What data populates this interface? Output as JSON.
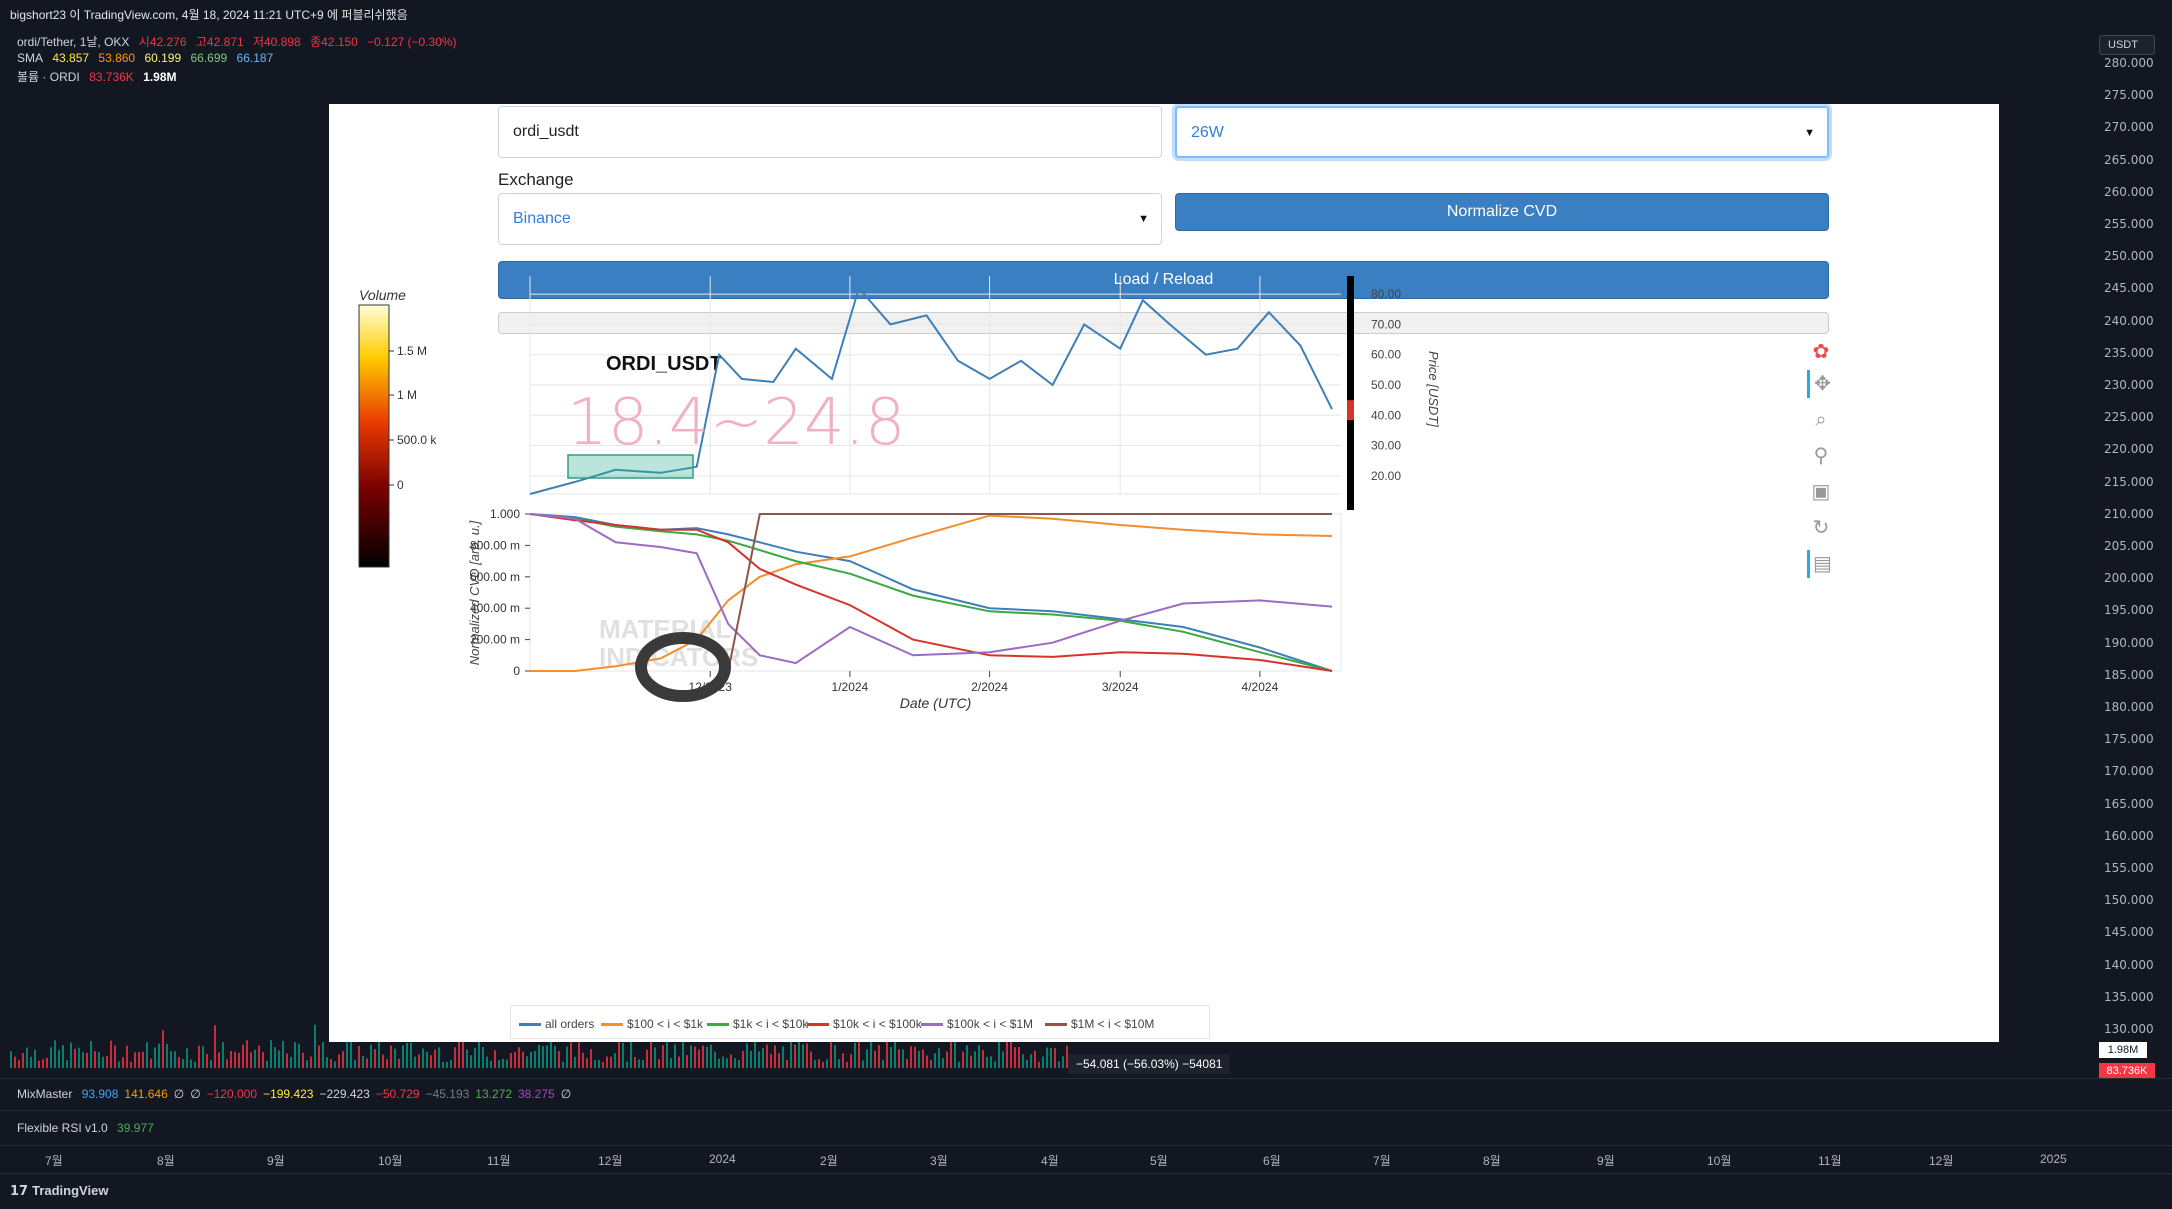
{
  "header": {
    "credit": "bigshort23 이 TradingView.com, 4월 18, 2024 11:21 UTC+9 에 퍼블리쉬했음",
    "symbol_line": "ordi/Tether, 1날, OKX",
    "o": "시42.276",
    "h": "고42.871",
    "l": "저40.898",
    "c": "종42.150",
    "change": "−0.127 (−0.30%)",
    "sma_label": "SMA",
    "sma_values": [
      "43.857",
      "53.860",
      "60.199",
      "66.699",
      "66.187"
    ],
    "vol_label": "볼륨 · ORDI",
    "vol_values": [
      "83.736K",
      "1.98M"
    ]
  },
  "price_axis": {
    "currency": "USDT",
    "labels": [
      "280.000",
      "275.000",
      "270.000",
      "265.000",
      "260.000",
      "255.000",
      "250.000",
      "245.000",
      "240.000",
      "235.000",
      "230.000",
      "225.000",
      "220.000",
      "215.000",
      "210.000",
      "205.000",
      "200.000",
      "195.000",
      "190.000",
      "185.000",
      "180.000",
      "175.000",
      "170.000",
      "165.000",
      "160.000",
      "155.000",
      "150.000",
      "145.000",
      "140.000",
      "135.000",
      "130.000"
    ],
    "vol_tag_1": "1.98M",
    "vol_tag_2": "83.736K"
  },
  "tooltip": "−54.081 (−56.03%) −54081",
  "indicators": {
    "mixmaster": {
      "name": "MixMaster",
      "values": [
        {
          "v": "93.908",
          "color": "#42a5f5"
        },
        {
          "v": "141.646",
          "color": "#ff9800"
        },
        {
          "v": "∅",
          "color": "#d1d4dc"
        },
        {
          "v": "∅",
          "color": "#d1d4dc"
        },
        {
          "v": "−120.000",
          "color": "#f23645"
        },
        {
          "v": "−199.423",
          "color": "#ffeb3b"
        },
        {
          "v": "−229.423",
          "color": "#d1d4dc"
        },
        {
          "v": "−50.729",
          "color": "#f23645"
        },
        {
          "v": "−45.193",
          "color": "#787b86"
        },
        {
          "v": "13.272",
          "color": "#4caf50"
        },
        {
          "v": "38.275",
          "color": "#ab47bc"
        },
        {
          "v": "∅",
          "color": "#d1d4dc"
        }
      ]
    },
    "rsi": {
      "name": "Flexible RSI v1.0",
      "value": "39.977"
    }
  },
  "time_axis": [
    "7월",
    "8월",
    "9월",
    "10월",
    "11월",
    "12월",
    "2024",
    "2월",
    "3월",
    "4월",
    "5월",
    "6월",
    "7월",
    "8월",
    "9월",
    "10월",
    "11월",
    "12월",
    "2025"
  ],
  "footer": {
    "logo": "TradingView"
  },
  "embed": {
    "symbol_input": "ordi_usdt",
    "period_select": "26W",
    "exchange_label": "Exchange",
    "exchange_select": "Binance",
    "normalize_btn": "Normalize CVD",
    "load_btn": "Load / Reload",
    "chart_title": "ORDI_USDT",
    "volume_title": "Volume",
    "colorbar_ticks": [
      "1.5 M",
      "1 M",
      "500.0 k",
      "0"
    ],
    "price_ylabel": "Price [USDT]",
    "price_ticks": [
      "80.00",
      "70.00",
      "60.00",
      "50.00",
      "40.00",
      "30.00",
      "20.00"
    ],
    "cvd_ylabel": "Normalized CVD [arb. u.]",
    "cvd_ticks": [
      "1.000",
      "800.00 m",
      "600.00 m",
      "400.00 m",
      "200.00 m",
      "0"
    ],
    "x_ticks": [
      "12/2023",
      "1/2024",
      "2/2024",
      "3/2024",
      "4/2024"
    ],
    "xlabel": "Date (UTC)",
    "annotation": "18.4~24.8",
    "watermark": "MATERIAL INDICATORS",
    "legend": [
      {
        "label": "all orders",
        "color": "#3d7fb6"
      },
      {
        "label": "$100 < i < $1k",
        "color": "#f28e2b"
      },
      {
        "label": "$1k < i < $10k",
        "color": "#3aa844"
      },
      {
        "label": "$10k < i < $100k",
        "color": "#d6342b"
      },
      {
        "label": "$100k < i < $1M",
        "color": "#9b6bc6"
      },
      {
        "label": "$1M < i < $10M",
        "color": "#8c564b"
      }
    ]
  },
  "chart_data": [
    {
      "type": "line",
      "title": "ORDI_USDT",
      "ylabel": "Price [USDT]",
      "xlabel": "",
      "x": [
        "2023-10-22",
        "2023-11-01",
        "2023-11-10",
        "2023-11-20",
        "2023-11-28",
        "2023-12-03",
        "2023-12-08",
        "2023-12-15",
        "2023-12-20",
        "2023-12-28",
        "2024-01-03",
        "2024-01-10",
        "2024-01-18",
        "2024-01-25",
        "2024-02-01",
        "2024-02-08",
        "2024-02-15",
        "2024-02-22",
        "2024-03-01",
        "2024-03-06",
        "2024-03-12",
        "2024-03-20",
        "2024-03-27",
        "2024-04-03",
        "2024-04-10",
        "2024-04-17"
      ],
      "series": [
        {
          "values": [
            14,
            18,
            22,
            21,
            23,
            60,
            52,
            51,
            62,
            52,
            82,
            70,
            73,
            58,
            52,
            58,
            50,
            70,
            62,
            78,
            70,
            60,
            62,
            74,
            63,
            42
          ]
        }
      ],
      "ylim": [
        14,
        86
      ]
    },
    {
      "type": "line",
      "ylabel": "Normalized CVD [arb. u.]",
      "xlabel": "Date (UTC)",
      "x": [
        "2023-10-22",
        "2023-11-01",
        "2023-11-10",
        "2023-11-20",
        "2023-11-28",
        "2023-12-05",
        "2023-12-12",
        "2023-12-20",
        "2024-01-01",
        "2024-01-15",
        "2024-02-01",
        "2024-02-15",
        "2024-03-01",
        "2024-03-15",
        "2024-04-01",
        "2024-04-17"
      ],
      "series": [
        {
          "name": "all orders",
          "values": [
            1.0,
            0.98,
            0.93,
            0.9,
            0.91,
            0.87,
            0.82,
            0.76,
            0.7,
            0.52,
            0.4,
            0.38,
            0.33,
            0.28,
            0.15,
            0.0
          ]
        },
        {
          "name": "$100 < i < $1k",
          "values": [
            0.0,
            0.0,
            0.03,
            0.08,
            0.2,
            0.45,
            0.6,
            0.68,
            0.73,
            0.85,
            0.99,
            0.97,
            0.93,
            0.9,
            0.87,
            0.86
          ]
        },
        {
          "name": "$1k < i < $10k",
          "values": [
            1.0,
            0.97,
            0.92,
            0.89,
            0.87,
            0.83,
            0.77,
            0.7,
            0.62,
            0.48,
            0.38,
            0.36,
            0.32,
            0.25,
            0.12,
            0.0
          ]
        },
        {
          "name": "$10k < i < $100k",
          "values": [
            1.0,
            0.96,
            0.93,
            0.9,
            0.9,
            0.82,
            0.65,
            0.55,
            0.42,
            0.2,
            0.1,
            0.09,
            0.12,
            0.11,
            0.07,
            0.0
          ]
        },
        {
          "name": "$100k < i < $1M",
          "values": [
            1.0,
            0.97,
            0.82,
            0.79,
            0.75,
            0.3,
            0.1,
            0.05,
            0.28,
            0.1,
            0.12,
            0.18,
            0.32,
            0.43,
            0.45,
            0.41
          ]
        },
        {
          "name": "$1M < i < $10M",
          "values": [
            null,
            null,
            null,
            null,
            null,
            0.0,
            1.0,
            1.0,
            1.0,
            1.0,
            1.0,
            1.0,
            1.0,
            1.0,
            1.0,
            1.0
          ]
        }
      ],
      "ylim": [
        0,
        1
      ]
    }
  ]
}
